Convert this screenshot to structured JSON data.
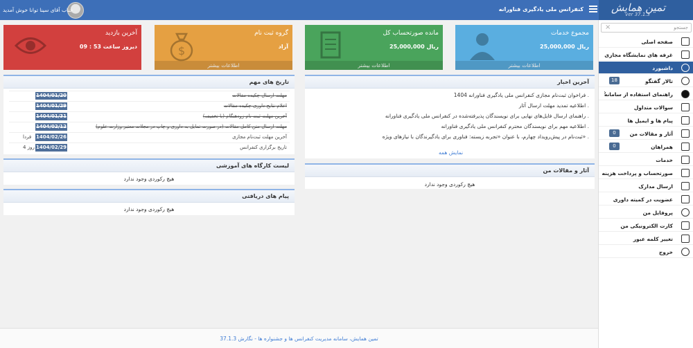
{
  "header": {
    "brand": "تمین همایش",
    "version": "ver 37.1.3",
    "conference_title": "کنفرانس ملی یادگیری فناورانه",
    "welcome": "جناب آقای سینا توانا خوش آمدید"
  },
  "sidebar": {
    "search_placeholder": "جستجو",
    "items": [
      {
        "label": "صفحه اصلی",
        "icon": "home-icon"
      },
      {
        "label": "غرفه های نمایشگاه مجازی",
        "icon": "booth-icon"
      },
      {
        "label": "داشبورد",
        "icon": "dashboard-icon",
        "active": true
      },
      {
        "label": "تالار گفتگو",
        "icon": "user-icon",
        "badge": "18"
      },
      {
        "label": "راهنمای استفاده از سامانه",
        "icon": "info-icon",
        "chevron": "›"
      },
      {
        "label": "سوالات متداول",
        "icon": "chat-icon"
      },
      {
        "label": "پیام ها و ایمیل ها",
        "icon": "message-icon"
      },
      {
        "label": "آثار و مقالات من",
        "icon": "article-icon",
        "badge": "0"
      },
      {
        "label": "همراهان",
        "icon": "people-icon",
        "badge": "0"
      },
      {
        "label": "خدمات",
        "icon": "services-icon"
      },
      {
        "label": "صورتحساب و پرداخت هزینه",
        "icon": "invoice-icon"
      },
      {
        "label": "ارسال مدارک",
        "icon": "upload-icon"
      },
      {
        "label": "عضویت در کمیته داوری",
        "icon": "committee-icon"
      },
      {
        "label": "پروفایل من",
        "icon": "profile-icon"
      },
      {
        "label": "کارت الکترونیکی من",
        "icon": "card-icon"
      },
      {
        "label": "تغییر کلمه عبور",
        "icon": "lock-icon"
      },
      {
        "label": "خروج",
        "icon": "logout-icon"
      }
    ]
  },
  "cards": [
    {
      "title": "مجموع خدمات",
      "value": "25,000,000 ریال",
      "footer": "اطلاعات بیشتر",
      "color": "#5aaee0",
      "icon": "person-icon"
    },
    {
      "title": "مانده صورتحساب کل",
      "value": "25,000,000 ریال",
      "footer": "اطلاعات بیشتر",
      "color": "#4aa45c",
      "icon": "document-icon"
    },
    {
      "title": "گروه ثبت نام",
      "value": "آزاد",
      "footer": "اطلاعات بیشتر",
      "color": "#e5a042",
      "icon": "money-bag-icon"
    },
    {
      "title": "آخرین بازدید",
      "value": "دیروز ساعت 53 : 09",
      "footer": "",
      "color": "#d2403e",
      "icon": "eye-icon"
    }
  ],
  "news": {
    "title": "آخرین اخبار",
    "items": [
      "فراخوان ثبت‌نام مجازی کنفرانس ملی یادگیری فناورانه 1404",
      "اطلاعیه تمدید مهلت ارسال آثار",
      "راهنمای ارسال فایل‌های نهایی برای نویسندگان پذیرفته‌شده در کنفرانس ملی یادگیری فناورانه",
      "اطلاعیه مهم برای نویسندگان محترم کنفرانس ملی یادگیری فناورانه",
      "ثبت‌نام در پیش‌رویداد چهارم، با عنوان «تجربه زیسته: فناوری برای یادگیرندگان با نیازهای ویژه»"
    ],
    "show_all": "نمایش همه"
  },
  "dates": {
    "title": "تاریخ های مهم",
    "rows": [
      {
        "label": "مهلت ارسال چکیده مقالات",
        "date": "1404/01/20",
        "remaining": "",
        "past": true
      },
      {
        "label": "اعلام نتایج داوری چکیده مقالات",
        "date": "1404/01/29",
        "remaining": "",
        "past": true
      },
      {
        "label": "آخرین مهلت ثبت نام زودهنگام (با تخفیف)",
        "date": "1404/01/31",
        "remaining": "",
        "past": true
      },
      {
        "label": "مهلت ارسال متن کامل مقالات (در صورت تمایل به داوری و چاپ در مجلات معتبر وزارت علوم)",
        "date": "1404/02/12",
        "remaining": "",
        "past": true
      },
      {
        "label": "آخرین مهلت ثبت‌نام مجازی",
        "date": "1404/02/26",
        "remaining": "فردا",
        "past": false
      },
      {
        "label": "تاریخ برگزاری کنفرانس",
        "date": "1404/02/29",
        "remaining": "4 روز",
        "past": false
      }
    ]
  },
  "articles": {
    "title": "آثار و مقالات من",
    "empty": "هیچ رکوردی وجود ندارد"
  },
  "workshops": {
    "title": "لیست کارگاه های آموزشی",
    "empty": "هیچ رکوردی وجود ندارد"
  },
  "messages": {
    "title": "پیام های دریافتی",
    "empty": "هیچ رکوردی وجود ندارد"
  },
  "footer": {
    "text": "تمین همایش، سامانه مدیریت کنفرانس ها و جشنواره ها - نگارش 37.1.3"
  }
}
